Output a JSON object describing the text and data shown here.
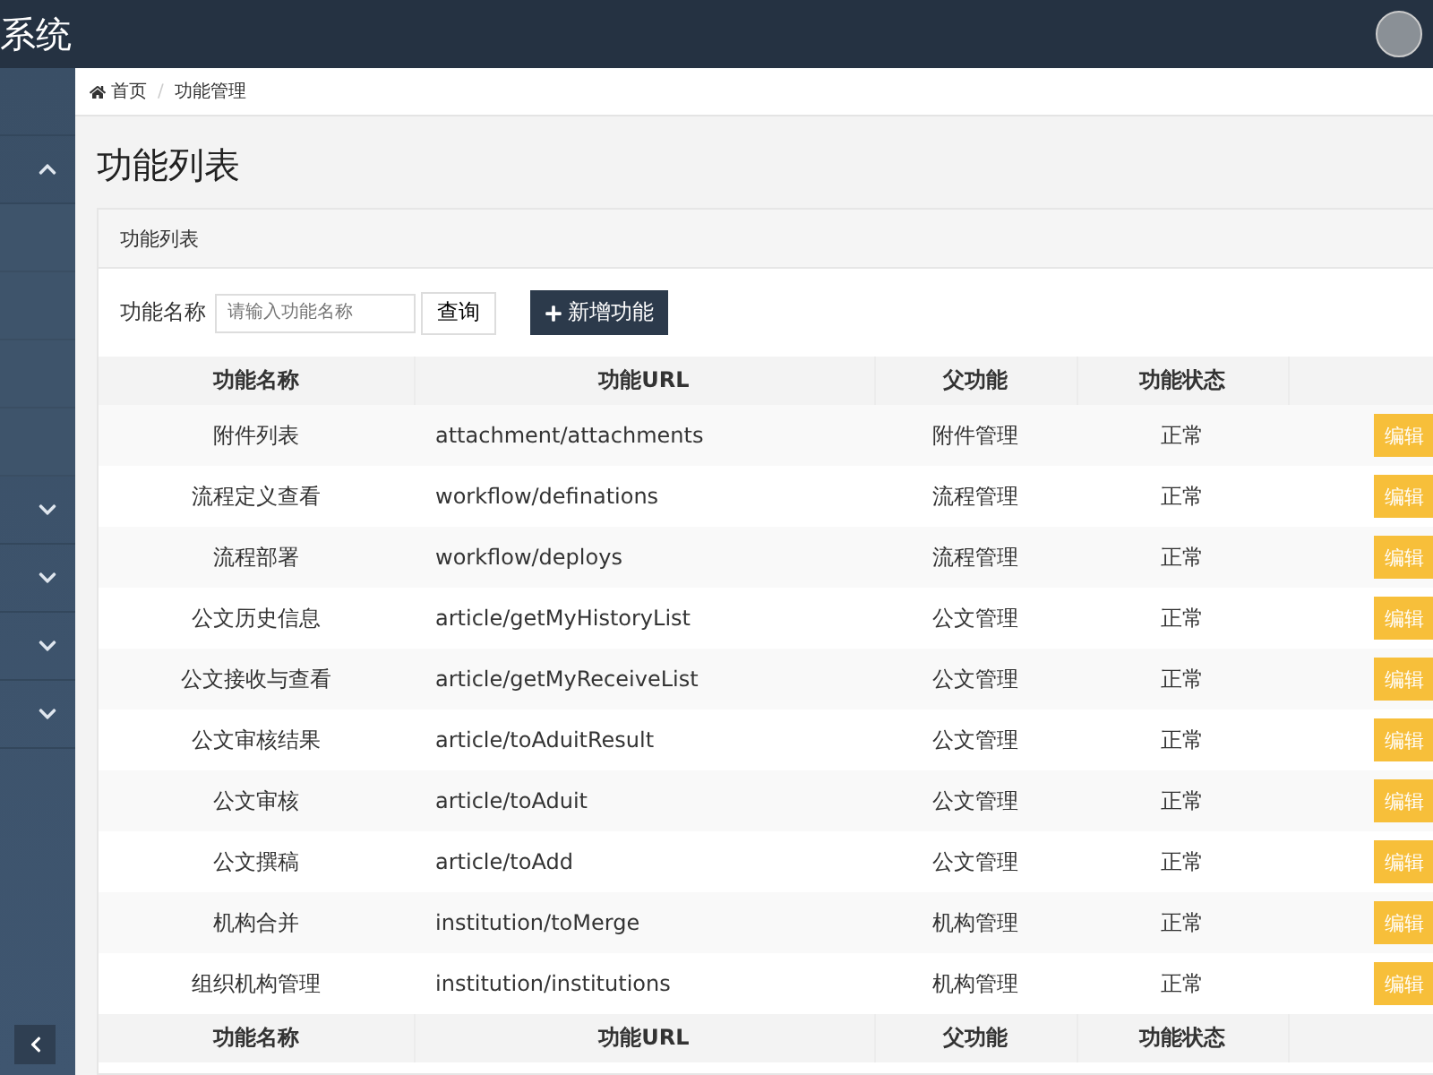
{
  "header": {
    "title": "系统"
  },
  "sidebar": {
    "menus": [
      {
        "expanded": true
      },
      {
        "expanded": false
      },
      {
        "expanded": false
      },
      {
        "expanded": false
      },
      {
        "expanded": false
      }
    ]
  },
  "breadcrumb_separator": "/",
  "breadcrumb": [
    {
      "label": "首页",
      "kind": "home"
    },
    {
      "label": "功能管理",
      "kind": "current"
    }
  ],
  "page_title": "功能列表",
  "panel": {
    "title": "功能列表",
    "search": {
      "label": "功能名称",
      "placeholder": "请输入功能名称",
      "button": "查询"
    },
    "add_button": "新增功能",
    "table": {
      "columns": [
        "功能名称",
        "功能URL",
        "父功能",
        "功能状态"
      ],
      "rows": [
        {
          "name": "附件列表",
          "url": "attachment/attachments",
          "parent": "附件管理",
          "status": "正常",
          "action": "编辑"
        },
        {
          "name": "流程定义查看",
          "url": "workflow/definations",
          "parent": "流程管理",
          "status": "正常",
          "action": "编辑"
        },
        {
          "name": "流程部署",
          "url": "workflow/deploys",
          "parent": "流程管理",
          "status": "正常",
          "action": "编辑"
        },
        {
          "name": "公文历史信息",
          "url": "article/getMyHistoryList",
          "parent": "公文管理",
          "status": "正常",
          "action": "编辑"
        },
        {
          "name": "公文接收与查看",
          "url": "article/getMyReceiveList",
          "parent": "公文管理",
          "status": "正常",
          "action": "编辑"
        },
        {
          "name": "公文审核结果",
          "url": "article/toAduitResult",
          "parent": "公文管理",
          "status": "正常",
          "action": "编辑"
        },
        {
          "name": "公文审核",
          "url": "article/toAduit",
          "parent": "公文管理",
          "status": "正常",
          "action": "编辑"
        },
        {
          "name": "公文撰稿",
          "url": "article/toAdd",
          "parent": "公文管理",
          "status": "正常",
          "action": "编辑"
        },
        {
          "name": "机构合并",
          "url": "institution/toMerge",
          "parent": "机构管理",
          "status": "正常",
          "action": "编辑"
        },
        {
          "name": "组织机构管理",
          "url": "institution/institutions",
          "parent": "机构管理",
          "status": "正常",
          "action": "编辑"
        }
      ],
      "footer_columns": [
        "功能名称",
        "功能URL",
        "父功能",
        "功能状态"
      ]
    }
  }
}
